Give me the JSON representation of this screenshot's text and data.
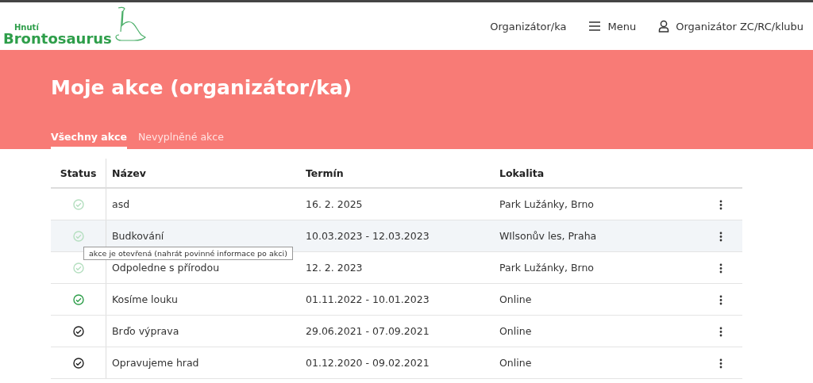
{
  "header": {
    "logo": {
      "small": "Hnutí",
      "big": "Brontosaurus"
    },
    "nav": [
      {
        "label": "Organizátor/ka",
        "kind": "plain"
      },
      {
        "label": "Menu",
        "kind": "menu"
      },
      {
        "label": "Organizátor ZC/RC/klubu",
        "kind": "user"
      }
    ]
  },
  "page_title": "Moje akce (organizátor/ka)",
  "tabs": [
    {
      "label": "Všechny akce",
      "selected": true
    },
    {
      "label": "Nevyplněné akce",
      "selected": false
    }
  ],
  "table": {
    "columns": [
      "Status",
      "Název",
      "Termín",
      "Lokalita"
    ],
    "rows": [
      {
        "kind": "open",
        "name": "asd",
        "date": "16. 2. 2025",
        "place": "Park Lužánky, Brno",
        "selected": false
      },
      {
        "kind": "open",
        "name": "Budkování",
        "date": "10.03.2023 - 12.03.2023",
        "place": "WIlsonův les, Praha",
        "selected": true
      },
      {
        "kind": "open",
        "name": "Odpoledne s přírodou",
        "date": "12. 2. 2023",
        "place": "Park Lužánky, Brno",
        "selected": false
      },
      {
        "kind": "done",
        "name": "Kosíme louku",
        "date": "01.11.2022 - 10.01.2023",
        "place": "Online",
        "selected": false
      },
      {
        "kind": "closed",
        "name": "Brďo výprava",
        "date": "29.06.2021 - 07.09.2021",
        "place": "Online",
        "selected": false
      },
      {
        "kind": "closed",
        "name": "Opravujeme hrad",
        "date": "01.12.2020 - 09.02.2021",
        "place": "Online",
        "selected": false
      }
    ]
  },
  "tooltip": {
    "text": "akce je otevřená (nahrát povinné informace po akci)"
  }
}
